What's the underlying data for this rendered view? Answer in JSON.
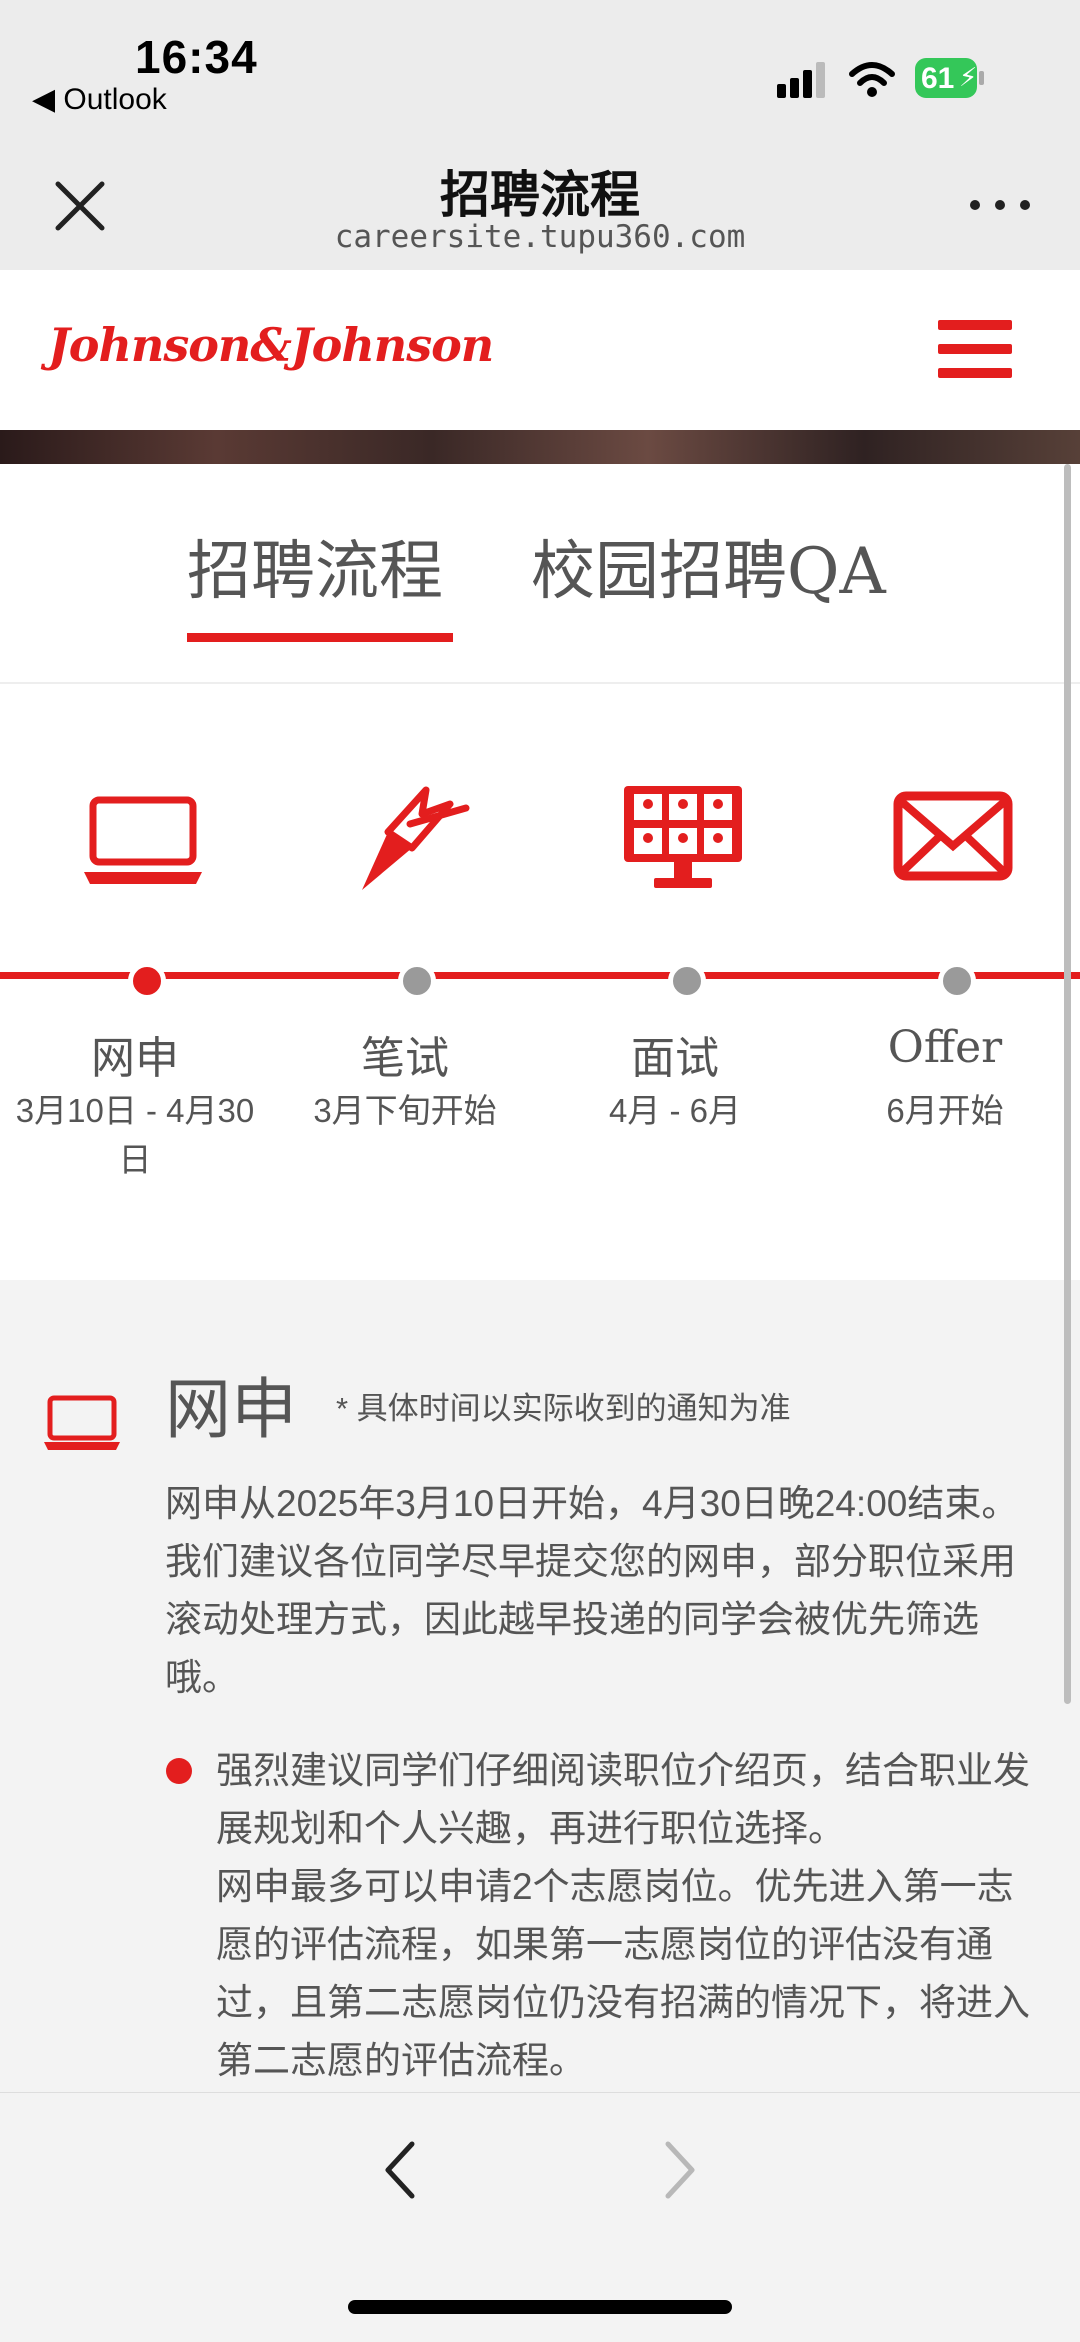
{
  "status_bar": {
    "time": "16:34",
    "back_app": "◀ Outlook",
    "battery": "61"
  },
  "browser": {
    "title": "招聘流程",
    "url": "careersite.tupu360.com"
  },
  "site": {
    "logo": "Johnson&Johnson",
    "brand_color": "#e31e1e"
  },
  "tabs": [
    {
      "label": "招聘流程",
      "active": true
    },
    {
      "label": "校园招聘QA",
      "active": false
    }
  ],
  "steps": [
    {
      "label": "网申",
      "date": "3月10日 - 4月30日",
      "icon": "laptop-icon",
      "active": true
    },
    {
      "label": "笔试",
      "date": "3月下旬开始",
      "icon": "pen-icon",
      "active": false
    },
    {
      "label": "面试",
      "date": "4月 - 6月",
      "icon": "video-interview-icon",
      "active": false
    },
    {
      "label": "Offer",
      "date": "6月开始",
      "icon": "envelope-icon",
      "active": false
    }
  ],
  "detail": {
    "title": "网申",
    "note": "* 具体时间以实际收到的通知为准",
    "body": "网申从2025年3月10日开始，4月30日晚24:00结束。我们建议各位同学尽早提交您的网申，部分职位采用滚动处理方式，因此越早投递的同学会被优先筛选哦。",
    "bullet": "强烈建议同学们仔细阅读职位介绍页，结合职业发展规划和个人兴趣，再进行职位选择。",
    "bullet_more": "网申最多可以申请2个志愿岗位。优先进入第一志愿的评估流程，如果第一志愿岗位的评估没有通过，且第二志愿岗位仍没有招满的情况下，将进入第二志愿的评估流程。"
  }
}
